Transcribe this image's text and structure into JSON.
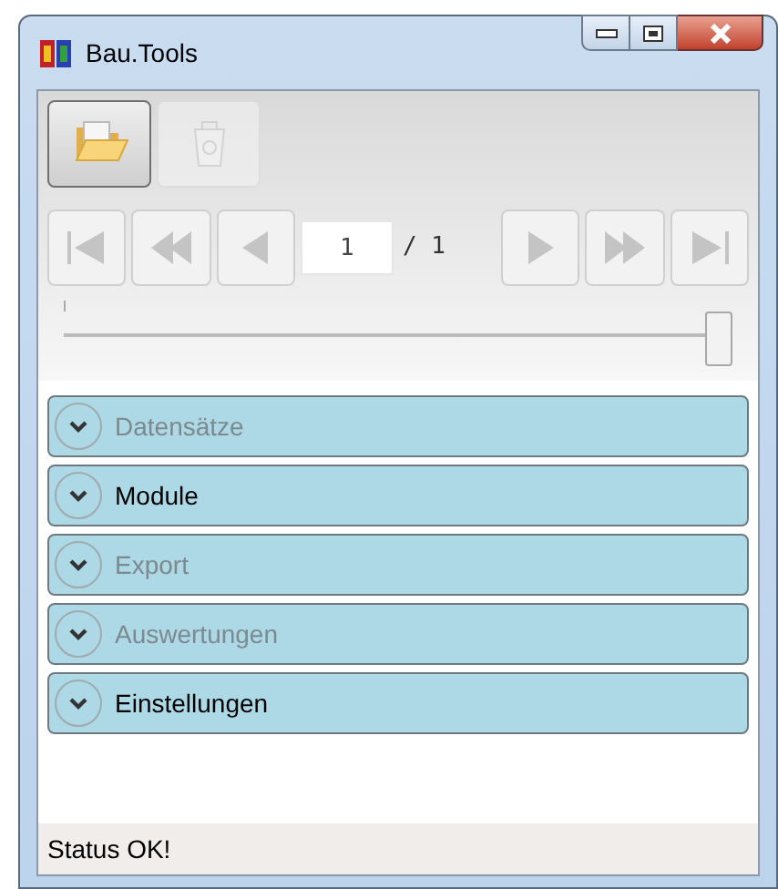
{
  "window": {
    "title": "Bau.Tools"
  },
  "toolbar": [
    {
      "kind": "open",
      "disabled": false
    },
    {
      "kind": "delete",
      "disabled": true
    }
  ],
  "navigation": {
    "buttons": [
      {
        "kind": "first",
        "disabled": true
      },
      {
        "kind": "fast-back",
        "disabled": true
      },
      {
        "kind": "back",
        "disabled": true
      },
      {
        "kind": "forward",
        "disabled": true
      },
      {
        "kind": "fast-forward",
        "disabled": true
      },
      {
        "kind": "last",
        "disabled": true
      }
    ],
    "page": "1",
    "total": "/ 1"
  },
  "slider": {
    "level": 1
  },
  "sections": [
    {
      "label": "Datensätze",
      "disabled": true
    },
    {
      "label": "Module",
      "disabled": false
    },
    {
      "label": "Export",
      "disabled": true
    },
    {
      "label": "Auswertungen",
      "disabled": true
    },
    {
      "label": "Einstellungen",
      "disabled": false
    }
  ],
  "status_bar": "Status OK!"
}
